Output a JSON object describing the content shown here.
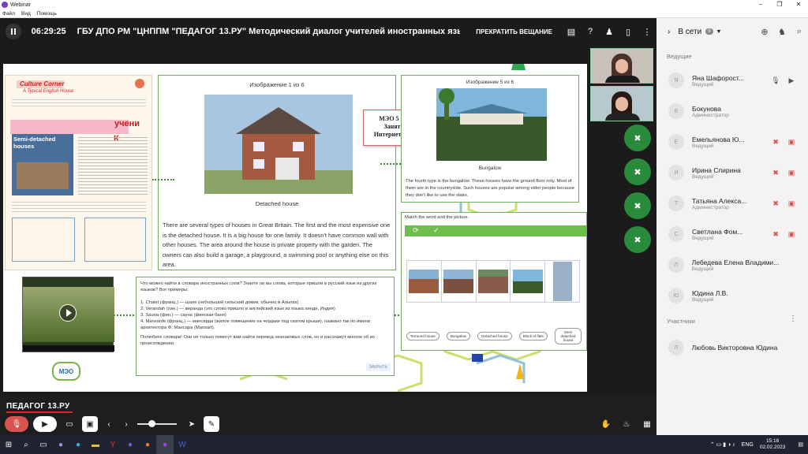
{
  "window": {
    "title": "Webinar"
  },
  "menu": [
    "Файл",
    "Вид",
    "Помощь"
  ],
  "topbar": {
    "timer": "06:29:25",
    "event_title": "ГБУ ДПО РМ \"ЦНППМ \"ПЕДАГОГ 13.РУ\"   Методический диалог учителей иностранных языков П",
    "stop_label": "ПРЕКРАТИТЬ ВЕЩАНИЕ"
  },
  "slide": {
    "book_title": "Culture Corner",
    "book_subtitle": "A Typical English House",
    "book_section": "Semi-detached houses",
    "book_word": "учени",
    "book_letter": "К",
    "image1_title": "Изображение 1 из 6",
    "image1_caption": "Detached house",
    "image1_text": "There are several types of houses in Great Britain. The first and the most expensive one is the detached house. It is a big house for one family. It doesn't have common wall with other houses. The area around the house is private property with the garden. The owners can also build a garage, a playground, a swimming pool or anything else on this area.",
    "info_card": [
      "МЭО 5 класс",
      "Занятие 4",
      "Интернет-урок 1"
    ],
    "image5_title": "Изображение 5 из 6",
    "image5_caption": "Bungalow",
    "image5_text": "The fourth type is the bungalow. These houses have the ground floor only. Most of them are in the countryside. Such houses are popular among elder people because they don't like to use the stairs.",
    "match_title": "Match the word and the picture.",
    "match_words": [
      "Terraced house",
      "Bungalow",
      "Detached house",
      "Block of flats",
      "Semi detached house"
    ],
    "note_text": "Что можно найти в словаре иностранных слов? Знаете ли вы слова, которые пришли в русский язык из других языков? Вот примеры:",
    "note_items": [
      "1. Chalet (франц.) — шале (небольшой сельский домик, обычно в Альпах)",
      "2. Verandah (хин.) — веранда (это слово пришло в английский язык из языка хинди, Индия)",
      "3. Sauna (фин.) — сауна (финская баня)",
      "4. Mansarde (франц.) — мансарда (жилое помещение на чердаке под скатом крыши), названо так по имени архитектора Ф. Мансара (Mansart)."
    ],
    "note_footer": "Полюбите словари! Они не только помогут вам найти перевод незнакомых слов, но и расскажут многое об их происхождении.",
    "close_label": "ЗАКРЫТЬ",
    "logo_text": "МЭО"
  },
  "brand": "ПЕДАГОГ 13.РУ",
  "sidepanel": {
    "online_label": "В сети",
    "online_count": "9",
    "hosts_label": "Ведущие",
    "participants_label": "Участники",
    "hosts": [
      {
        "initial": "Я",
        "name": "Яна Шафорост...",
        "role": "Ведущий"
      },
      {
        "initial": "Б",
        "name": "Бокунова",
        "role": "Администратор"
      },
      {
        "initial": "Е",
        "name": "Емельянова Ю...",
        "role": "Ведущий"
      },
      {
        "initial": "И",
        "name": "Ирина Спирина",
        "role": "Ведущий"
      },
      {
        "initial": "Т",
        "name": "Татьяна Алекса...",
        "role": "Администратор"
      },
      {
        "initial": "С",
        "name": "Светлана Фом...",
        "role": "Ведущий"
      },
      {
        "initial": "Л",
        "name": "Лебедева Елена Владими...",
        "role": "Ведущий"
      },
      {
        "initial": "Ю",
        "name": "Юдина Л.В.",
        "role": "Ведущий"
      }
    ],
    "participants": [
      {
        "initial": "Л",
        "name": "Любовь Викторовна Юдина"
      }
    ]
  },
  "taskbar": {
    "lang": "ENG",
    "time": "15:16",
    "date": "02.02.2023"
  },
  "colors": {
    "accent_green": "#2a8a3c",
    "mic_off_red": "#d9534f",
    "slide_border": "#6fae5f"
  }
}
